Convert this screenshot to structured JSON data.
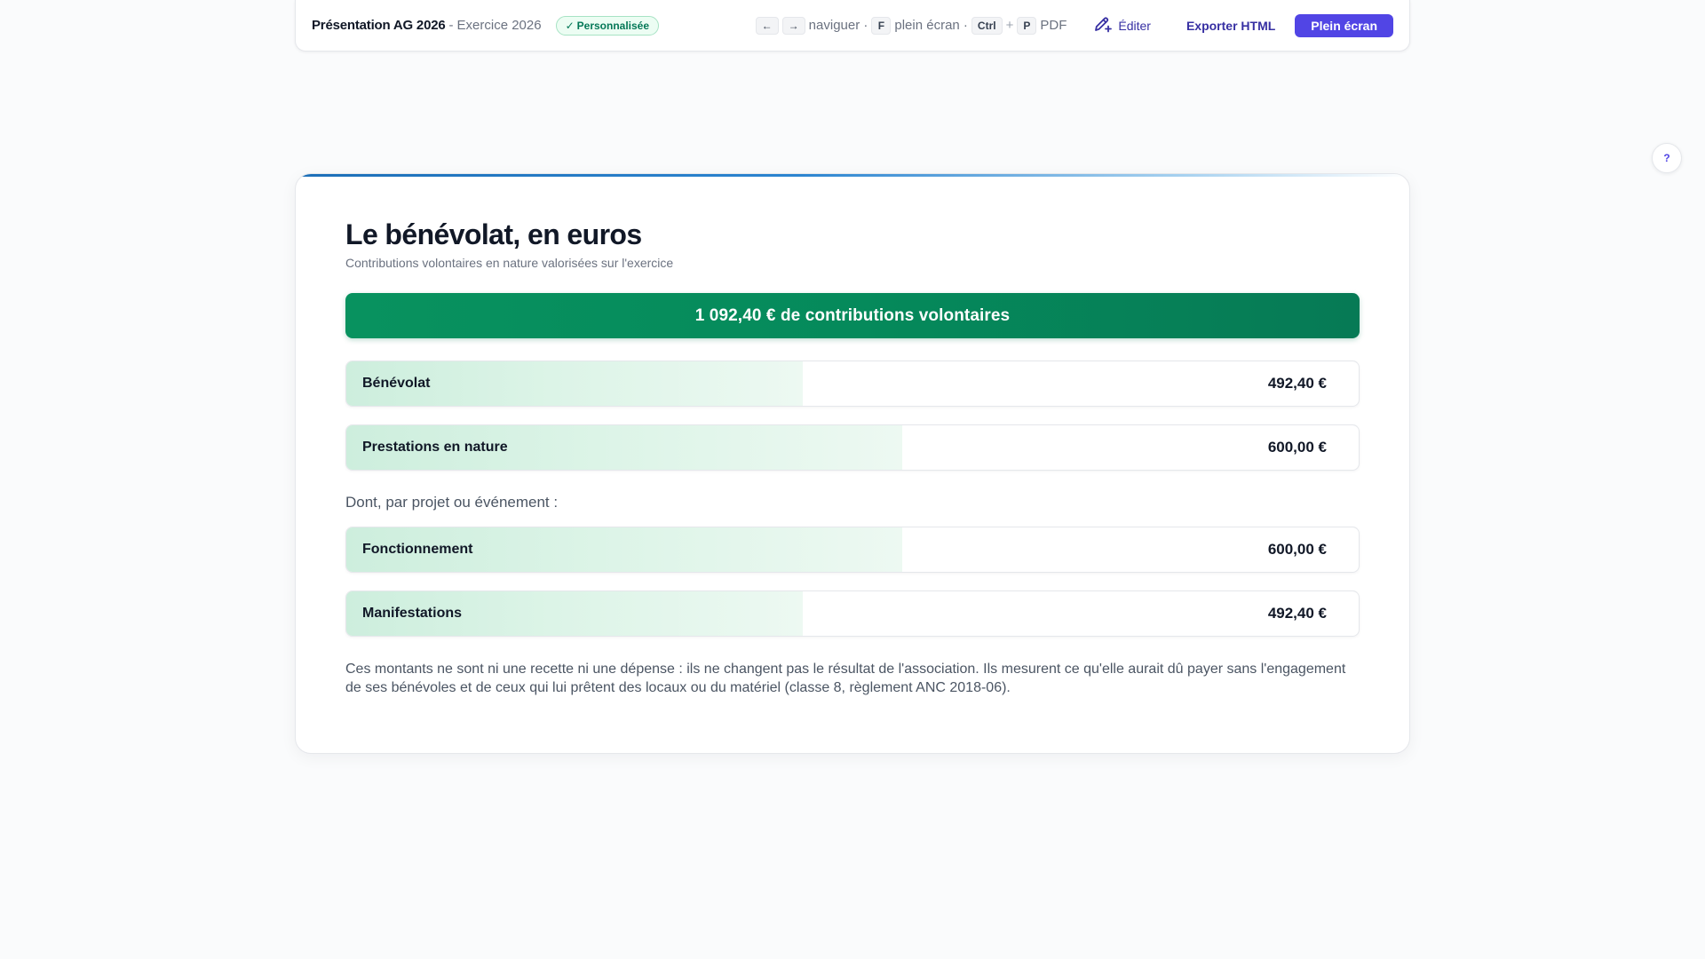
{
  "toolbar": {
    "title": "Présentation AG 2026",
    "separator": " - ",
    "subtitle": "Exercice 2026",
    "badge_check": "✓",
    "badge_label": "Personnalisée",
    "key_prev": "←",
    "key_next": "→",
    "hint_navigate": "naviguer ·",
    "key_fullscreen": "F",
    "hint_fullscreen": "plein écran ·",
    "key_ctrl": "Ctrl",
    "key_plus": "+",
    "key_p": "P",
    "hint_pdf": "PDF",
    "edit_label": "Éditer",
    "export_label": "Exporter HTML",
    "fullscreen_label": "Plein écran"
  },
  "help": {
    "label": "?"
  },
  "slide": {
    "title": "Le bénévolat, en euros",
    "subtitle": "Contributions volontaires en nature valorisées sur l'exercice",
    "total_banner": "1 092,40 € de contributions volontaires",
    "rows": [
      {
        "label": "Bénévolat",
        "value": "492,40 €",
        "fill_fraction": 0.451
      },
      {
        "label": "Prestations en nature",
        "value": "600,00 €",
        "fill_fraction": 0.549
      }
    ],
    "section_label": "Dont, par projet ou événement :",
    "project_rows": [
      {
        "label": "Fonctionnement",
        "value": "600,00 €",
        "fill_fraction": 0.549
      },
      {
        "label": "Manifestations",
        "value": "492,40 €",
        "fill_fraction": 0.451
      }
    ],
    "footnote": "Ces montants ne sont ni une recette ni une dépense : ils ne changent pas le résultat de l'association. Ils mesurent ce qu'elle aurait dû payer sans l'engagement de ses bénévoles et de ceux qui lui prêtent des locaux ou du matériel (classe 8, règlement ANC 2018-06)."
  },
  "colors": {
    "accent": "#5145e5",
    "banner_green": "#058a5b",
    "badge_green": "#047857"
  },
  "icons": {
    "edit": "pen-plus-icon",
    "help": "help-icon",
    "check": "check-icon"
  }
}
